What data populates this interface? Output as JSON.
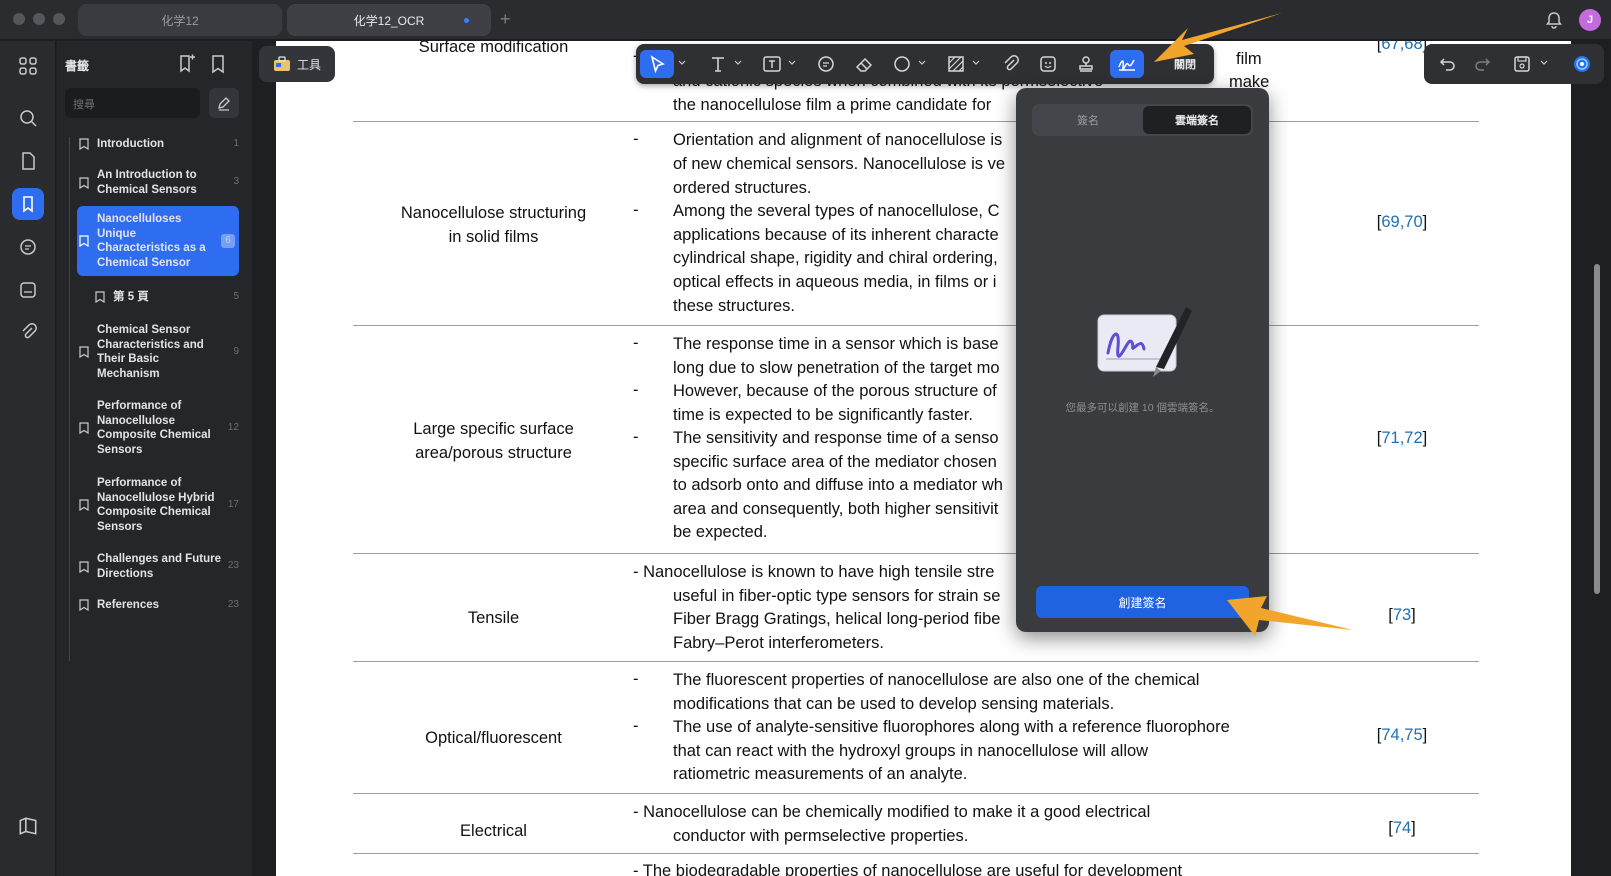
{
  "window": {
    "tabs": [
      {
        "label": "化学12",
        "active": false
      },
      {
        "label": "化学12_OCR",
        "active": true
      }
    ],
    "add_tab": "+",
    "avatar_initial": "J"
  },
  "sidebar": {
    "title": "書籤",
    "search_placeholder": "搜尋",
    "bookmarks": [
      {
        "label": "Introduction",
        "page": "1"
      },
      {
        "label": "An Introduction to Chemical Sensors",
        "page": "3"
      },
      {
        "label": "Nanocelluloses Unique Characteristics as a Chemical Sensor",
        "page": "6",
        "selected": true
      },
      {
        "label": "第 5 頁",
        "page": "5",
        "child": true
      },
      {
        "label": "Chemical Sensor Characteristics and Their Basic Mechanism",
        "page": "9"
      },
      {
        "label": "Performance of Nanocellulose Composite Chemical Sensors",
        "page": "12"
      },
      {
        "label": "Performance of Nanocellulose Hybrid Composite Chemical Sensors",
        "page": "17"
      },
      {
        "label": "Challenges and Future Directions",
        "page": "23"
      },
      {
        "label": "References",
        "page": "23"
      }
    ]
  },
  "toolbar": {
    "tools_label": "工具",
    "close_label": "關閉"
  },
  "signature_popover": {
    "tab_signature": "簽名",
    "tab_cloud_signature": "雲端簽名",
    "note": "您最多可以創建 10 個雲端簽名。",
    "create_button": "創建簽名"
  },
  "document": {
    "rows": [
      {
        "category": "Surface modification",
        "lines": [
          "and cationic species when combined with its permselective",
          "the nanocellulose film a prime candidate for"
        ],
        "right_fragments": [
          "film",
          "make"
        ],
        "ref": "67,68"
      },
      {
        "category_lines": [
          "Nanocellulose structuring",
          "in solid films"
        ],
        "lines": [
          "Orientation and alignment of nanocellulose is",
          "of new chemical sensors. Nanocellulose is ve",
          "ordered structures.",
          "Among the several types of nanocellulose, C",
          "applications because of its inherent characte",
          "cylindrical shape, rigidity and chiral ordering,",
          "optical effects in aqueous media, in films or i",
          "these structures."
        ],
        "ref": "69,70"
      },
      {
        "category_lines": [
          "Large specific surface",
          "area/porous structure"
        ],
        "lines": [
          "The response time in a sensor which is base",
          "long due to slow penetration of the target mo",
          "However, because of the porous structure of",
          "time is expected to be significantly faster.",
          "The sensitivity and response time of a senso",
          "specific surface area of the mediator chosen",
          "to adsorb onto and diffuse into a mediator wh",
          "area and consequently, both higher sensitivit",
          "be expected."
        ],
        "ref": "71,72"
      },
      {
        "category": "Tensile",
        "lines": [
          "- Nanocellulose is known to have high tensile stre",
          "useful in fiber-optic type sensors for strain se",
          "Fiber Bragg Gratings, helical long-period fibe",
          "Fabry–Perot interferometers."
        ],
        "ref": "73"
      },
      {
        "category": "Optical/fluorescent",
        "lines": [
          "The fluorescent properties of nanocellulose are also one of the chemical",
          "modifications that can be used to develop sensing materials.",
          "The use of analyte-sensitive fluorophores along with a reference fluorophore",
          "that can react with the hydroxyl groups in nanocellulose will allow",
          "ratiometric measurements of an analyte."
        ],
        "ref": "74,75"
      },
      {
        "category": "Electrical",
        "lines": [
          "- Nanocellulose can be chemically modified to make it a good electrical",
          "conductor with permselective properties."
        ],
        "ref": "74"
      },
      {
        "lines": [
          "- The biodegradable properties of nanocellulose are useful for development"
        ]
      }
    ]
  },
  "colors": {
    "accent": "#2f6df0",
    "arrow": "#f2a52b",
    "link": "#1f6fb5"
  }
}
